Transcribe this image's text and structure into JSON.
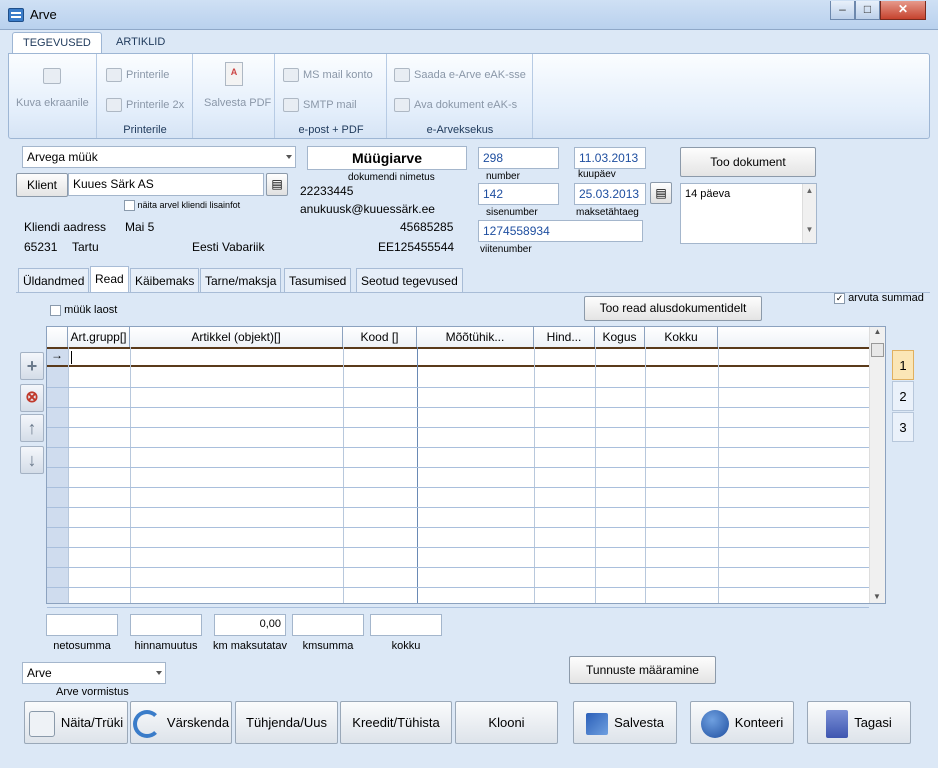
{
  "window": {
    "title": "Arve",
    "controls": {
      "minimize": "–",
      "maximize": "□",
      "close": "✕"
    }
  },
  "ribbon": {
    "tabs": [
      "TEGEVUSED",
      "ARTIKLID"
    ],
    "kuva": "Kuva ekraanile",
    "printer_group": {
      "label": "Printerile",
      "btn1": "Printerile",
      "btn2": "Printerile 2x"
    },
    "pdf": "Salvesta PDF",
    "epost_group": {
      "label": "e-post + PDF",
      "btn1": "MS mail konto",
      "btn2": "SMTP mail"
    },
    "earve_group": {
      "label": "e-Arveksekus",
      "btn1": "Saada e-Arve eAK-sse",
      "btn2": "Ava dokument eAK-s"
    }
  },
  "header": {
    "doc_type": "Arvega müük",
    "doc_name": "Müügiarve",
    "doc_name_label": "dokumendi nimetus",
    "number": "298",
    "number_label": "number",
    "date": "11.03.2013",
    "date_label": "kuupäev",
    "internal_number": "142",
    "internal_number_label": "sisenumber",
    "due_date": "25.03.2013",
    "due_date_label": "maksetähtaeg",
    "reference": "1274558934",
    "reference_label": "viitenumber",
    "fetch_doc_button": "Too dokument",
    "payment_terms": "14 päeva",
    "client_button": "Klient",
    "client_name": "Kuues Särk AS",
    "show_client_info": "näita arvel kliendi lisainfot",
    "client_code": "22233445",
    "client_email": "anukuusk@kuuessärk.ee",
    "address_label": "Kliendi aadress",
    "street": "Mai 5",
    "phone": "45685285",
    "postal": "65231",
    "city": "Tartu",
    "country": "Eesti Vabariik",
    "vat": "EE125455544"
  },
  "tabs": [
    "Üldandmed",
    "Read",
    "Käibemaks",
    "Tarne/maksja",
    "Tasumised",
    "Seotud tegevused"
  ],
  "rows_panel": {
    "sale_from_stock": "müük laost",
    "fetch_rows_button": "Too read alusdokumentidelt",
    "calc_sums": "arvuta summad",
    "columns": [
      "Art.grupp[]",
      "Artikkel (objekt)[]",
      "Kood []",
      "Mõõtühik...",
      "Hind...",
      "Kogus",
      "Kokku"
    ],
    "current_row_marker": "→",
    "pages": [
      "1",
      "2",
      "3"
    ]
  },
  "sums": [
    {
      "label": "netosumma",
      "value": ""
    },
    {
      "label": "hinnamuutus",
      "value": ""
    },
    {
      "label": "km maksutatav",
      "value": "0,00"
    },
    {
      "label": "kmsumma",
      "value": ""
    },
    {
      "label": "kokku",
      "value": ""
    }
  ],
  "format": {
    "value": "Arve",
    "label": "Arve vormistus"
  },
  "ids_button": "Tunnuste määramine",
  "bottom": {
    "naita": "Näita/Trüki",
    "varskenda": "Värskenda",
    "tuhjenda": "Tühjenda/Uus",
    "kreedit": "Kreedit/Tühista",
    "klooni": "Klooni",
    "salvesta": "Salvesta",
    "konteeri": "Konteeri",
    "tagasi": "Tagasi"
  }
}
